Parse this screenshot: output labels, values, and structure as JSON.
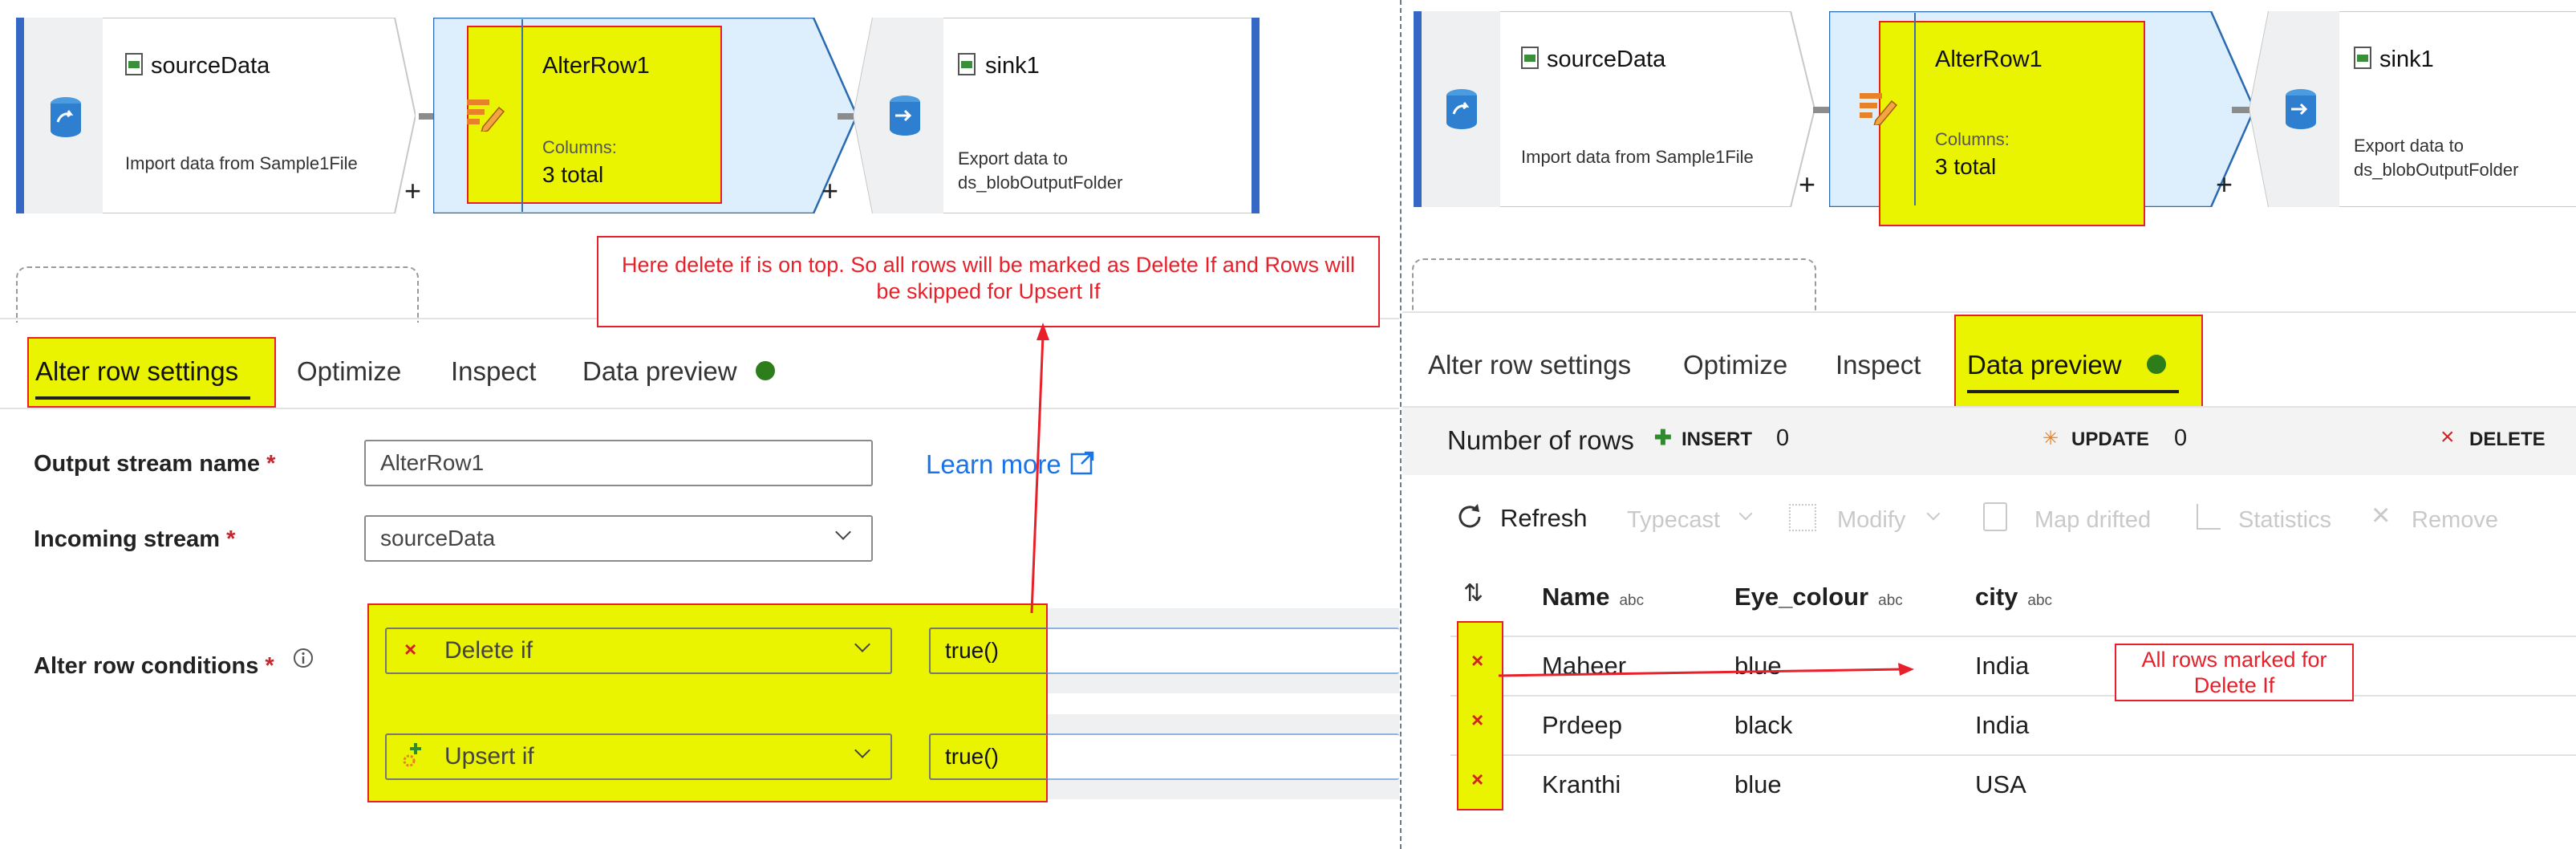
{
  "left": {
    "source": {
      "title": "sourceData",
      "subtitle": "Import data from Sample1File"
    },
    "alter": {
      "title": "AlterRow1",
      "columns_label": "Columns:",
      "columns_value": "3 total"
    },
    "sink": {
      "title": "sink1",
      "subtitle_line1": "Export data to",
      "subtitle_line2": "ds_blobOutputFolder"
    },
    "plus": "+",
    "tabs": [
      "Alter row settings",
      "Optimize",
      "Inspect",
      "Data preview"
    ],
    "callout": "Here delete if is on top. So all rows will be marked as Delete If and Rows will be skipped for Upsert If",
    "form": {
      "output_label": "Output stream name",
      "output_value": "AlterRow1",
      "learn_more": "Learn more",
      "incoming_label": "Incoming stream",
      "incoming_value": "sourceData",
      "conditions_label": "Alter row conditions",
      "required": "*",
      "conditions": [
        {
          "type": "Delete if",
          "expr": "true()"
        },
        {
          "type": "Upsert if",
          "expr": "true()"
        }
      ]
    }
  },
  "right": {
    "source": {
      "title": "sourceData",
      "subtitle": "Import data from Sample1File"
    },
    "alter": {
      "title": "AlterRow1",
      "columns_label": "Columns:",
      "columns_value": "3 total"
    },
    "sink": {
      "title": "sink1",
      "subtitle_line1": "Export data to",
      "subtitle_line2": "ds_blobOutputFolder"
    },
    "plus": "+",
    "tabs": [
      "Alter row settings",
      "Optimize",
      "Inspect",
      "Data preview"
    ],
    "stats": {
      "label": "Number of rows",
      "insert_label": "INSERT",
      "insert_value": "0",
      "update_label": "UPDATE",
      "update_value": "0",
      "delete_label": "DELETE"
    },
    "toolbar": {
      "refresh": "Refresh",
      "typecast": "Typecast",
      "modify": "Modify",
      "map_drifted": "Map drifted",
      "statistics": "Statistics",
      "remove": "Remove"
    },
    "table": {
      "columns": [
        {
          "name": "Name",
          "type": "abc"
        },
        {
          "name": "Eye_colour",
          "type": "abc"
        },
        {
          "name": "city",
          "type": "abc"
        }
      ],
      "rows": [
        [
          "Maheer",
          "blue",
          "India"
        ],
        [
          "Prdeep",
          "black",
          "India"
        ],
        [
          "Kranthi",
          "blue",
          "USA"
        ]
      ]
    },
    "callout": "All rows marked for Delete If"
  },
  "colors": {
    "highlight": "#ebf400",
    "annotation": "#e8202a",
    "accent": "#1b73e8",
    "status_green": "#2e7d1b"
  }
}
